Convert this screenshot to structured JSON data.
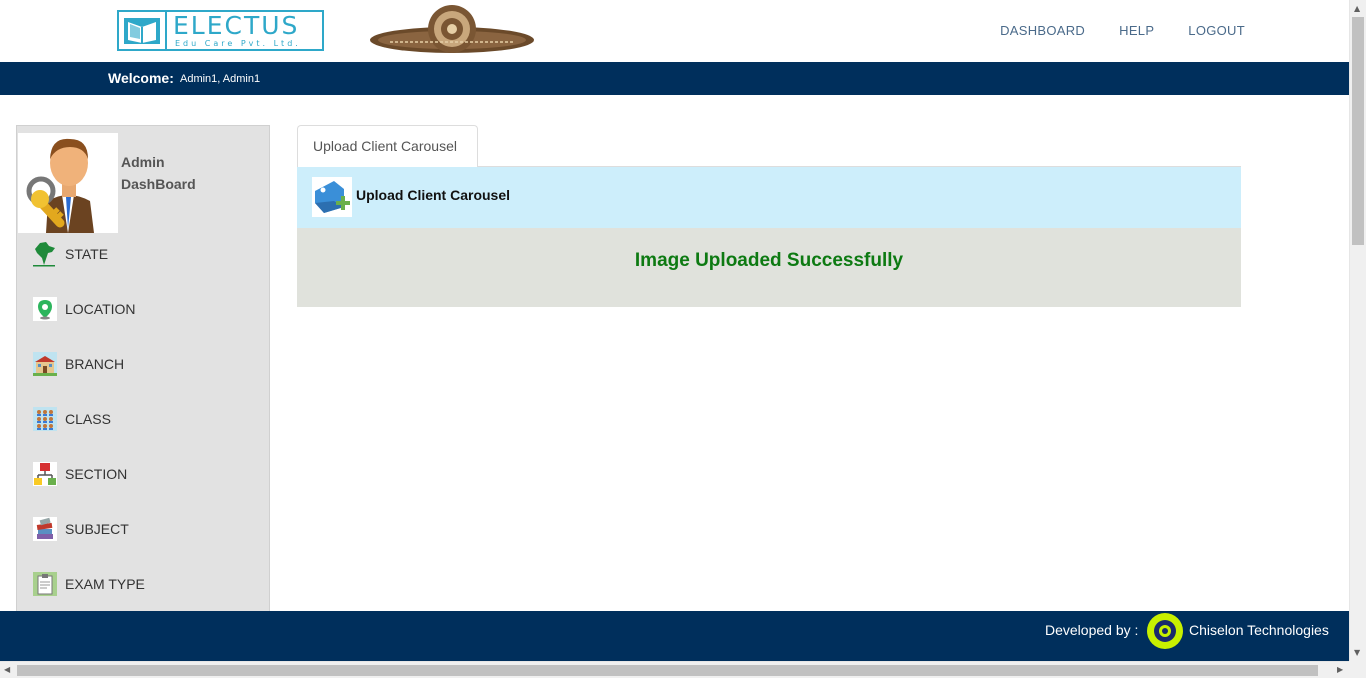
{
  "header": {
    "logo": {
      "name": "ELECTUS",
      "subtitle": "Edu Care Pvt. Ltd."
    },
    "nav": [
      "DASHBOARD",
      "HELP",
      "LOGOUT"
    ]
  },
  "welcome": {
    "label": "Welcome:",
    "user": "Admin1, Admin1"
  },
  "sidebar": {
    "title_line1": "Admin",
    "title_line2": "DashBoard",
    "items": [
      {
        "label": "STATE",
        "icon": "india-map-icon"
      },
      {
        "label": "LOCATION",
        "icon": "location-pin-icon"
      },
      {
        "label": "BRANCH",
        "icon": "school-building-icon"
      },
      {
        "label": "CLASS",
        "icon": "classroom-icon"
      },
      {
        "label": "SECTION",
        "icon": "hierarchy-icon"
      },
      {
        "label": "SUBJECT",
        "icon": "books-icon"
      },
      {
        "label": "EXAM TYPE",
        "icon": "clipboard-icon"
      }
    ]
  },
  "main": {
    "tab_label": "Upload Client Carousel",
    "panel_title": "Upload Client Carousel",
    "message": "Image Uploaded Successfully"
  },
  "footer": {
    "label": "Developed by :",
    "company": "Chiselon Technologies"
  },
  "colors": {
    "navy": "#002f5c",
    "success": "#0d7a12",
    "panel_head": "#cdeefb",
    "panel_body": "#e0e2dc",
    "sidebar": "#e2e2e2",
    "electus": "#2ea8c9"
  }
}
